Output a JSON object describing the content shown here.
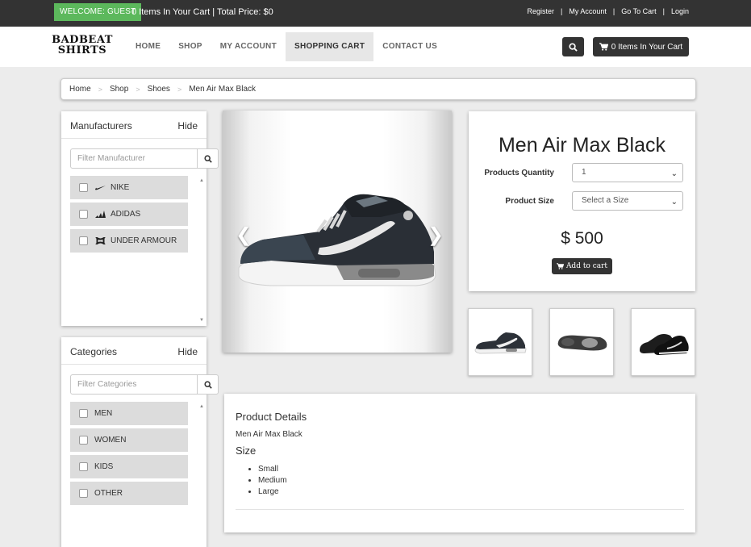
{
  "topbar": {
    "welcome": "WELCOME: GUEST",
    "cart_info": "0 Items In Your Cart | Total Price: $0",
    "links": [
      "Register",
      "My Account",
      "Go To Cart",
      "Login"
    ],
    "separator": "|"
  },
  "nav": {
    "logo_line1": "BADBEAT",
    "logo_line2": "SHIRTS",
    "menu": [
      "HOME",
      "SHOP",
      "MY ACCOUNT",
      "SHOPPING CART",
      "CONTACT US"
    ],
    "active_menu": "SHOPPING CART",
    "cart_button": "0 Items In Your Cart"
  },
  "breadcrumb": {
    "items": [
      "Home",
      "Shop",
      "Shoes",
      "Men Air Max Black"
    ],
    "separator": ">"
  },
  "manufacturers": {
    "title": "Manufacturers",
    "hide_label": "Hide",
    "filter_placeholder": "Filter Manufacturer",
    "items": [
      {
        "label": "NIKE",
        "icon": "nike-swoosh-icon"
      },
      {
        "label": "ADIDAS",
        "icon": "adidas-logo-icon"
      },
      {
        "label": "UNDER ARMOUR",
        "icon": "under-armour-logo-icon"
      }
    ]
  },
  "categories": {
    "title": "Categories",
    "hide_label": "Hide",
    "filter_placeholder": "Filter Categories",
    "items": [
      {
        "label": "MEN"
      },
      {
        "label": "WOMEN"
      },
      {
        "label": "KIDS"
      },
      {
        "label": "OTHER"
      }
    ]
  },
  "product": {
    "title": "Men Air Max Black",
    "quantity_label": "Products Quantity",
    "quantity_value": "1",
    "size_label": "Product Size",
    "size_value": "Select a Size",
    "price": "$ 500",
    "add_to_cart": "Add to cart",
    "carousel_slides": 3,
    "carousel_active": 1
  },
  "details": {
    "heading": "Product Details",
    "name": "Men Air Max Black",
    "size_heading": "Size",
    "sizes": [
      "Small",
      "Medium",
      "Large"
    ]
  },
  "colors": {
    "topbar": "#333333",
    "welcome_badge": "#5cb85c",
    "button_dark": "#333333",
    "page_bg": "#ececec"
  }
}
